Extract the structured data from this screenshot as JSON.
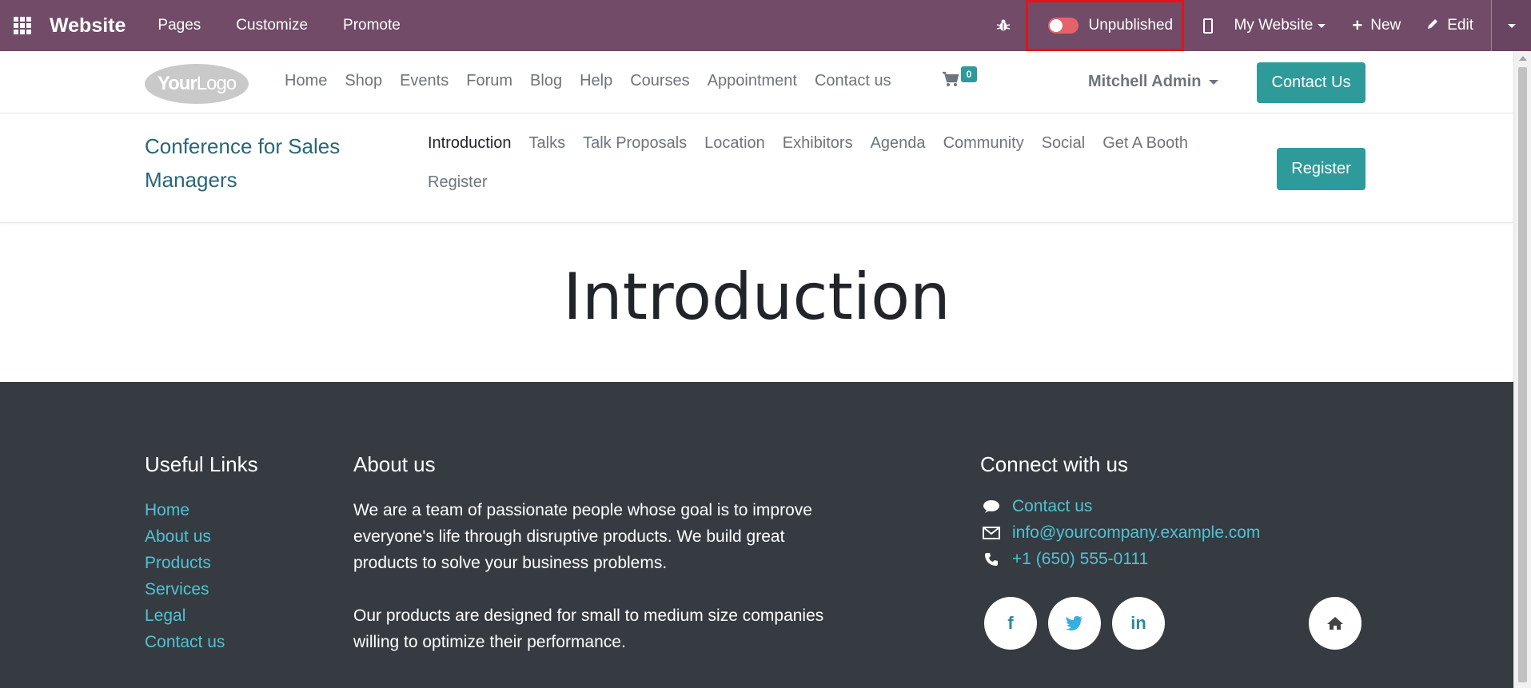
{
  "topbar": {
    "brand": "Website",
    "menu": [
      "Pages",
      "Customize",
      "Promote"
    ],
    "publish_label": "Unpublished",
    "my_website": "My Website",
    "new_label": "New",
    "edit_label": "Edit"
  },
  "header": {
    "logo_bold": "Your",
    "logo_light": "Logo",
    "nav": [
      "Home",
      "Shop",
      "Events",
      "Forum",
      "Blog",
      "Help",
      "Courses",
      "Appointment",
      "Contact us"
    ],
    "cart_count": "0",
    "user_name": "Mitchell Admin",
    "contact_button": "Contact Us"
  },
  "event": {
    "title": "Conference for Sales Managers",
    "nav": [
      "Introduction",
      "Talks",
      "Talk Proposals",
      "Location",
      "Exhibitors",
      "Agenda",
      "Community",
      "Social",
      "Get A Booth",
      "Register"
    ],
    "register_button": "Register"
  },
  "main": {
    "title": "Introduction"
  },
  "footer": {
    "useful_links_title": "Useful Links",
    "useful_links": [
      "Home",
      "About us",
      "Products",
      "Services",
      "Legal",
      "Contact us"
    ],
    "about_title": "About us",
    "about_p1": "We are a team of passionate people whose goal is to improve everyone's life through disruptive products. We build great products to solve your business problems.",
    "about_p2": "Our products are designed for small to medium size companies willing to optimize their performance.",
    "connect_title": "Connect with us",
    "contact_link": "Contact us",
    "email": "info@yourcompany.example.com",
    "phone": "+1 (650) 555-0111",
    "social": {
      "facebook": "f",
      "linkedin": "in"
    }
  }
}
